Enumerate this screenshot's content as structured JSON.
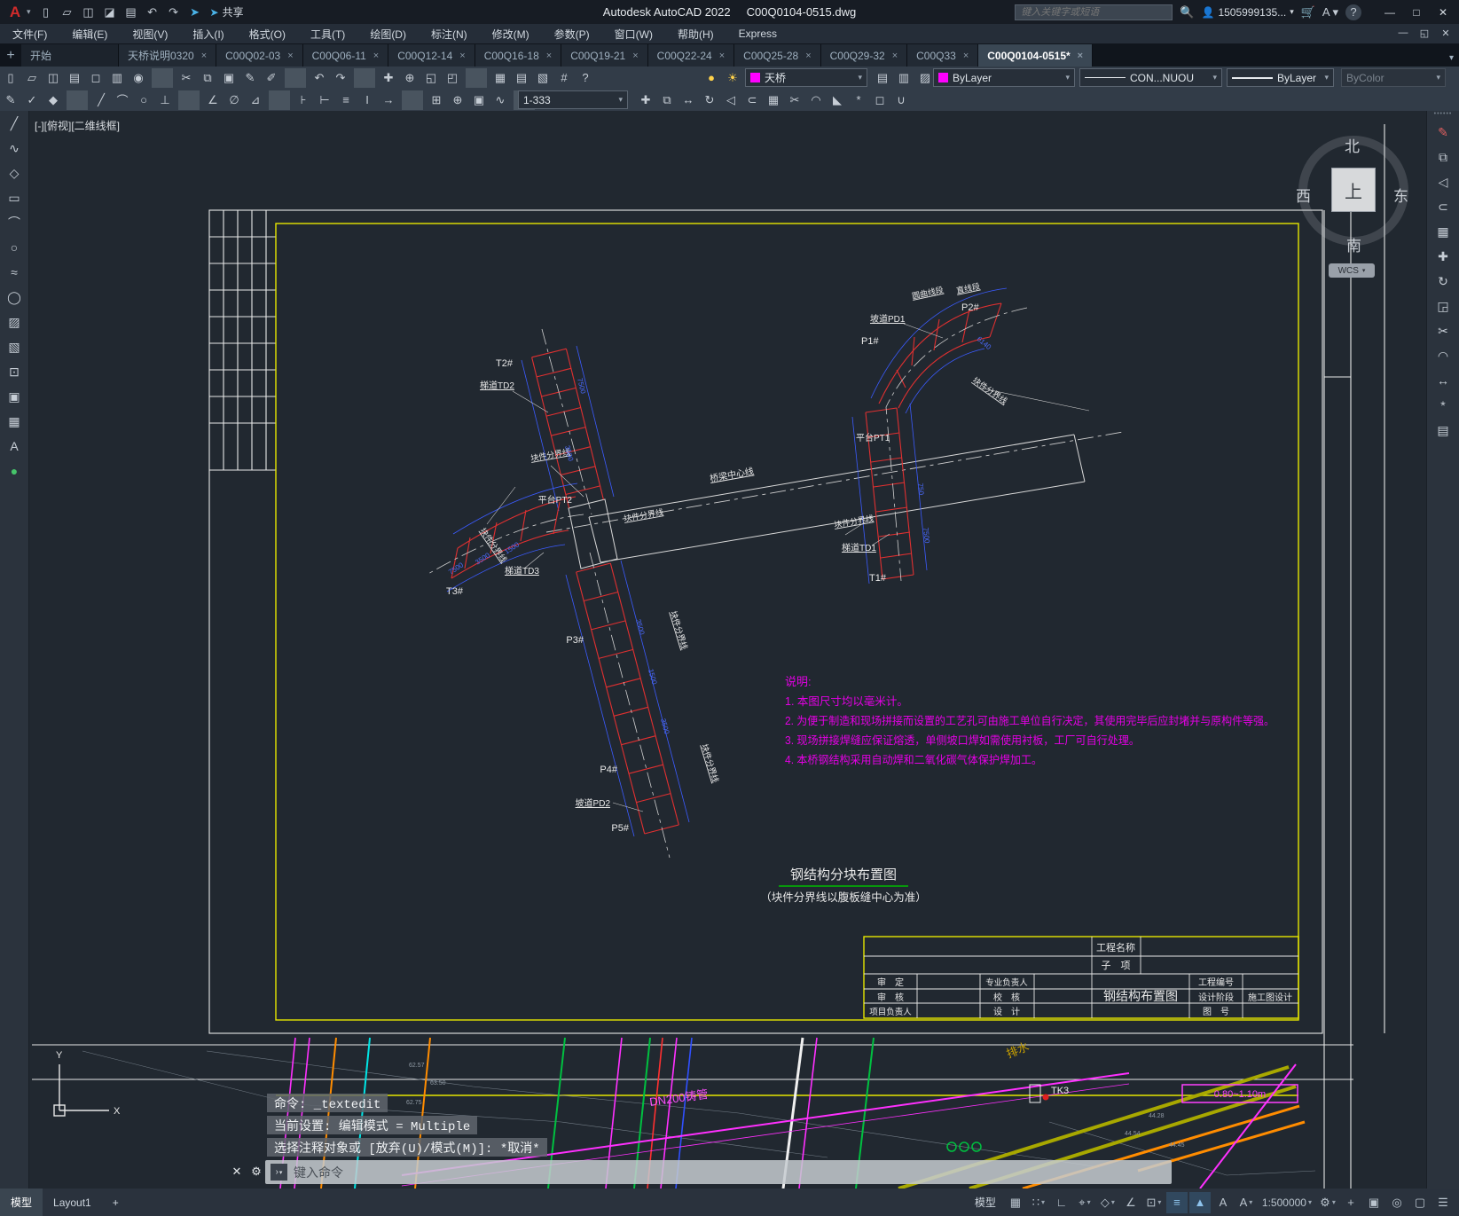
{
  "icons": {
    "close": "✕",
    "caret": "▾",
    "tab_close": "×",
    "plus": "+",
    "search": "🔍",
    "min": "—",
    "max": "□",
    "restore": "◱",
    "wrench": "⚙",
    "prompt": "›"
  },
  "titlebar": {
    "app_title": "Autodesk AutoCAD 2022",
    "doc_title": "C00Q0104-0515.dwg",
    "share_label": "共享",
    "search_placeholder": "键入关键字或短语",
    "account": "1505999135...",
    "quick_icons": [
      {
        "name": "new-file-icon",
        "glyph": "▯"
      },
      {
        "name": "open-file-icon",
        "glyph": "▱"
      },
      {
        "name": "save-icon",
        "glyph": "◫"
      },
      {
        "name": "save-as-icon",
        "glyph": "◪"
      },
      {
        "name": "plot-icon",
        "glyph": "▤"
      },
      {
        "name": "undo-icon",
        "glyph": "↶"
      },
      {
        "name": "redo-icon",
        "glyph": "↷"
      },
      {
        "name": "share-plane-icon",
        "glyph": "➤",
        "color": "#4ab3e8"
      }
    ]
  },
  "menubar": {
    "items": [
      "文件(F)",
      "编辑(E)",
      "视图(V)",
      "插入(I)",
      "格式(O)",
      "工具(T)",
      "绘图(D)",
      "标注(N)",
      "修改(M)",
      "参数(P)",
      "窗口(W)",
      "帮助(H)",
      "Express"
    ]
  },
  "tabs": {
    "items": [
      {
        "label": "开始",
        "closable": false
      },
      {
        "label": "天桥说明0320"
      },
      {
        "label": "C00Q02-03"
      },
      {
        "label": "C00Q06-11"
      },
      {
        "label": "C00Q12-14"
      },
      {
        "label": "C00Q16-18"
      },
      {
        "label": "C00Q19-21"
      },
      {
        "label": "C00Q22-24"
      },
      {
        "label": "C00Q25-28"
      },
      {
        "label": "C00Q29-32"
      },
      {
        "label": "C00Q33"
      },
      {
        "label": "C00Q0104-0515*",
        "active": true
      }
    ]
  },
  "ribbon": {
    "row1_icons": [
      {
        "name": "qnew-icon",
        "glyph": "▯"
      },
      {
        "name": "open-icon",
        "glyph": "▱"
      },
      {
        "name": "qsave-icon",
        "glyph": "◫"
      },
      {
        "name": "plot-icon",
        "glyph": "▤"
      },
      {
        "name": "plot-preview-icon",
        "glyph": "◻"
      },
      {
        "name": "publish-icon",
        "glyph": "▥"
      },
      {
        "name": "web-icon",
        "glyph": "◉"
      },
      {
        "sep": true
      },
      {
        "name": "cut-icon",
        "glyph": "✂"
      },
      {
        "name": "copy-clip-icon",
        "glyph": "⧉"
      },
      {
        "name": "paste-icon",
        "glyph": "▣"
      },
      {
        "name": "match-properties-icon",
        "glyph": "✎"
      },
      {
        "name": "edit-icon",
        "glyph": "✐"
      },
      {
        "sep": true
      },
      {
        "name": "undo-icon",
        "glyph": "↶"
      },
      {
        "name": "redo-icon",
        "glyph": "↷"
      },
      {
        "sep": true
      },
      {
        "name": "pan-icon",
        "glyph": "✚"
      },
      {
        "name": "zoom-realtime-icon",
        "glyph": "⊕"
      },
      {
        "name": "zoom-window-icon",
        "glyph": "◱"
      },
      {
        "name": "zoom-previous-icon",
        "glyph": "◰"
      },
      {
        "sep": true
      },
      {
        "name": "viewports-icon",
        "glyph": "▦"
      },
      {
        "name": "named-views-icon",
        "glyph": "▤"
      },
      {
        "name": "sheet-set-icon",
        "glyph": "▧"
      },
      {
        "name": "calculator-icon",
        "glyph": "#"
      },
      {
        "name": "help-icon",
        "glyph": "?"
      }
    ],
    "layer_state_icons": [
      {
        "name": "layer-on-icon",
        "glyph": "●",
        "color": "#ffd24a"
      },
      {
        "name": "layer-sun-icon",
        "glyph": "☀",
        "color": "#ffd24a"
      },
      {
        "name": "layer-isolate-icon",
        "glyph": "◻"
      },
      {
        "name": "layer-lock-icon",
        "glyph": "◉",
        "color": "#ffb020"
      }
    ],
    "layer_combo": {
      "value": "天桥",
      "color": "#ff00ff"
    },
    "layer_tool_icons": [
      {
        "name": "layer-properties-icon",
        "glyph": "▤"
      },
      {
        "name": "layer-states-icon",
        "glyph": "▥"
      },
      {
        "name": "layer-walk-icon",
        "glyph": "▨"
      }
    ],
    "color_combo": {
      "value": "ByLayer",
      "color": "#ff00ff"
    },
    "linetype_combo": {
      "value": "CON...NUOU"
    },
    "lineweight_combo": {
      "value": "ByLayer"
    },
    "plotstyle_combo": {
      "value": "ByColor"
    },
    "style_combo": {
      "value": "1-333"
    },
    "row2_icons": [
      {
        "name": "matchprop-icon",
        "glyph": "✎"
      },
      {
        "name": "edit-attribute-icon",
        "glyph": "✓"
      },
      {
        "name": "purge-icon",
        "glyph": "◆"
      },
      {
        "sep": true
      },
      {
        "name": "line-icon",
        "glyph": "╱"
      },
      {
        "name": "arc-icon",
        "glyph": "⌒"
      },
      {
        "name": "circle-icon",
        "glyph": "○"
      },
      {
        "name": "tangent-icon",
        "glyph": "⊥"
      },
      {
        "sep": true
      },
      {
        "name": "angle-icon",
        "glyph": "∠"
      },
      {
        "name": "no-circle-icon",
        "glyph": "∅"
      },
      {
        "name": "triangle-icon",
        "glyph": "⊿"
      },
      {
        "sep": true
      },
      {
        "name": "quick-dim-icon",
        "glyph": "⊦"
      },
      {
        "name": "linear-dim-icon",
        "glyph": "⊢"
      },
      {
        "name": "continue-dim-icon",
        "glyph": "≡"
      },
      {
        "name": "baseline-dim-icon",
        "glyph": "I"
      },
      {
        "name": "jogged-dim-icon",
        "glyph": "→"
      },
      {
        "sep": true
      },
      {
        "name": "insert-block-icon",
        "glyph": "⊞"
      },
      {
        "name": "center-mark-icon",
        "glyph": "⊕"
      },
      {
        "name": "region-icon",
        "glyph": "▣"
      },
      {
        "name": "revision-cloud-icon",
        "glyph": "∿"
      },
      {
        "sep": true
      },
      {
        "name": "brush-icon",
        "glyph": "✎"
      },
      {
        "name": "text-style-icon",
        "glyph": "A"
      },
      {
        "name": "update-icon",
        "glyph": "⟳"
      }
    ],
    "row2_right_icons": [
      {
        "name": "move-icon",
        "glyph": "✚"
      },
      {
        "name": "copy-icon",
        "glyph": "⧉"
      },
      {
        "name": "stretch-icon",
        "glyph": "↔"
      },
      {
        "name": "rotate-icon",
        "glyph": "↻"
      },
      {
        "name": "mirror-icon",
        "glyph": "◁"
      },
      {
        "name": "offset-icon",
        "glyph": "⊂"
      },
      {
        "name": "array-icon",
        "glyph": "▦"
      },
      {
        "name": "trim-icon",
        "glyph": "✂"
      },
      {
        "name": "fillet-icon",
        "glyph": "◠"
      },
      {
        "name": "chamfer-icon",
        "glyph": "◣"
      },
      {
        "name": "explode-icon",
        "glyph": "*"
      },
      {
        "name": "erase-icon",
        "glyph": "◻"
      },
      {
        "name": "join-icon",
        "glyph": "∪"
      }
    ]
  },
  "left_toolbar": [
    {
      "name": "line-tool-icon",
      "glyph": "╱"
    },
    {
      "name": "polyline-tool-icon",
      "glyph": "∿"
    },
    {
      "name": "polygon-tool-icon",
      "glyph": "◇"
    },
    {
      "name": "rectangle-tool-icon",
      "glyph": "▭"
    },
    {
      "name": "arc-tool-icon",
      "glyph": "⌒"
    },
    {
      "name": "circle-tool-icon",
      "glyph": "○"
    },
    {
      "name": "spline-tool-icon",
      "glyph": "≈"
    },
    {
      "name": "ellipse-tool-icon",
      "glyph": "◯"
    },
    {
      "name": "hatch-tool-icon",
      "glyph": "▨"
    },
    {
      "name": "gradient-tool-icon",
      "glyph": "▧"
    },
    {
      "name": "boundary-tool-icon",
      "glyph": "⊡"
    },
    {
      "name": "region-tool-icon",
      "glyph": "▣"
    },
    {
      "name": "table-tool-icon",
      "glyph": "▦"
    },
    {
      "name": "text-tool-icon",
      "glyph": "A"
    },
    {
      "name": "point-tool-icon",
      "glyph": "●",
      "color": "#46c46a"
    }
  ],
  "right_toolbar": [
    {
      "name": "erase-tool-icon",
      "glyph": "✎",
      "color": "#e06060"
    },
    {
      "name": "copy-tool-icon",
      "glyph": "⧉"
    },
    {
      "name": "mirror-tool-icon",
      "glyph": "◁"
    },
    {
      "name": "offset-tool-icon",
      "glyph": "⊂"
    },
    {
      "name": "array-tool-icon",
      "glyph": "▦"
    },
    {
      "name": "move-tool-icon",
      "glyph": "✚"
    },
    {
      "name": "rotate-tool-icon",
      "glyph": "↻"
    },
    {
      "name": "scale-tool-icon",
      "glyph": "◲"
    },
    {
      "name": "trim-tool-icon",
      "glyph": "✂"
    },
    {
      "name": "fillet-tool-icon",
      "glyph": "◠"
    },
    {
      "name": "stretch-tool-icon",
      "glyph": "↔"
    },
    {
      "name": "explode-tool-icon",
      "glyph": "*"
    },
    {
      "name": "properties-tool-icon",
      "glyph": "▤"
    }
  ],
  "viewport": {
    "label": "[-][俯视][二维线框]"
  },
  "viewcube": {
    "north": "北",
    "south": "南",
    "east": "东",
    "west": "西",
    "top": "上",
    "wcs": "WCS"
  },
  "drawing": {
    "labels": {
      "t1": "T1#",
      "t2": "T2#",
      "t3": "T3#",
      "p1": "P1#",
      "p2": "P2#",
      "p3": "P3#",
      "p4": "P4#",
      "p5": "P5#",
      "td1": "梯道TD1",
      "td2": "梯道TD2",
      "td3": "梯道TD3",
      "pd1": "坡道PD1",
      "pd2": "坡道PD2",
      "pt1": "平台PT1",
      "pt2": "平台PT2",
      "centerline": "桥梁中心线",
      "block_boundary": "块件分界线",
      "curve_seg": "圆曲线段",
      "straight_seg": "直线段"
    },
    "dims": [
      "7500",
      "3500",
      "1500",
      "3500",
      "1500",
      "6140",
      "750",
      "7500"
    ],
    "notes": {
      "heading": "说明:",
      "n1": "1. 本图尺寸均以毫米计。",
      "n2": "2. 为便于制造和现场拼接而设置的工艺孔可由施工单位自行决定，其使用完毕后应封堵并与原构件等强。",
      "n3": "3. 现场拼接焊缝应保证熔透，单侧坡口焊如需使用衬板，工厂可自行处理。",
      "n4": "4. 本桥钢结构采用自动焊和二氧化碳气体保护焊加工。"
    },
    "figure_title": "钢结构分块布置图",
    "figure_subtitle": "（块件分界线以腹板缝中心为准）",
    "titleblock": {
      "project_label": "工程名称",
      "subitem_label": "子　项",
      "approve_label": "审　定",
      "check_label": "审　核",
      "pm_label": "项目负责人",
      "discipline_label": "专业负责人",
      "proof_label": "校　核",
      "design_label": "设　计",
      "drawing_name": "钢结构布置图",
      "code_label": "工程编号",
      "stage_label": "设计阶段",
      "stage_value": "施工图设计",
      "sheet_label": "图　号"
    },
    "survey": {
      "paishui": "排水",
      "dn200": "DN200铸管",
      "tk3": "TK3",
      "pink_note": "0.80~1.10m",
      "e1": "62.57",
      "e2": "63.50",
      "e3": "62.75",
      "e4": "44.54",
      "e5": "44.28",
      "e6": "44.45"
    }
  },
  "command": {
    "line1": "命令: _textedit",
    "line2": "当前设置: 编辑模式 = Multiple",
    "line3": "选择注释对象或 [放弃(U)/模式(M)]: *取消*",
    "input_placeholder": "键入命令"
  },
  "statusbar": {
    "model_tab": "模型",
    "layout_tab": "Layout1",
    "add_tab": "+",
    "model_btn": "模型",
    "right_icons": [
      {
        "name": "grid-icon",
        "glyph": "▦"
      },
      {
        "name": "snap-mode-icon",
        "glyph": "∷",
        "caret": true
      },
      {
        "name": "ortho-icon",
        "glyph": "∟"
      },
      {
        "name": "polar-tracking-icon",
        "glyph": "⌖",
        "caret": true
      },
      {
        "name": "isodraft-icon",
        "glyph": "◇",
        "caret": true
      },
      {
        "name": "osnap-tracking-icon",
        "glyph": "∠"
      },
      {
        "name": "osnap-icon",
        "glyph": "⊡",
        "caret": true
      },
      {
        "name": "lineweight-display-icon",
        "glyph": "≡",
        "hl": true
      },
      {
        "name": "selection-cycling-icon",
        "glyph": "▲",
        "hl": true
      },
      {
        "name": "annotation-visibility-icon",
        "glyph": "A"
      },
      {
        "name": "autoscale-icon",
        "glyph": "A",
        "caret": true
      },
      {
        "name": "annotation-scale-select",
        "glyph": "1:500000",
        "caret": true,
        "text": true
      },
      {
        "name": "workspace-switch-icon",
        "glyph": "⚙",
        "caret": true
      },
      {
        "name": "crosshair-icon",
        "glyph": "+"
      },
      {
        "name": "isolate-objects-icon",
        "glyph": "▣"
      },
      {
        "name": "graphics-performance-icon",
        "glyph": "◎"
      },
      {
        "name": "clean-screen-icon",
        "glyph": "▢"
      },
      {
        "name": "customize-icon",
        "glyph": "☰"
      }
    ]
  }
}
